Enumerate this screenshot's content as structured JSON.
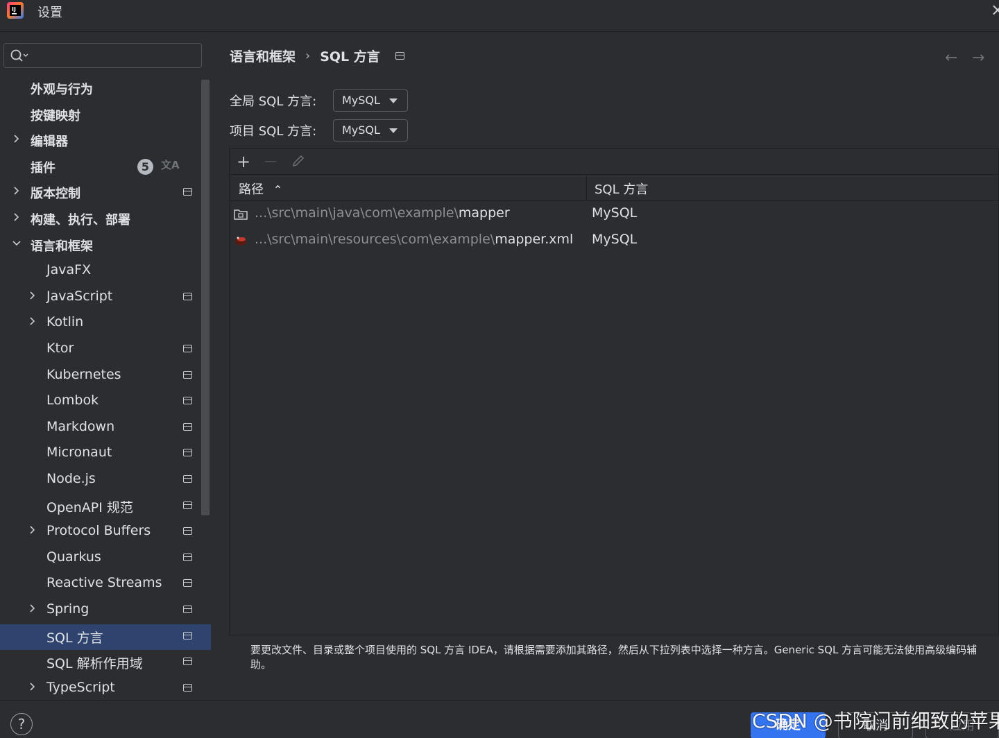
{
  "window": {
    "title": "设置",
    "close_glyph": "×"
  },
  "colors": {
    "background": "#2b2d30",
    "selection": "#2e436e",
    "primary_button": "#3574f0",
    "text": "#dfe1e5",
    "dim_text": "#8c8f94"
  },
  "sidebar": {
    "search_value": "",
    "items": [
      {
        "label": "外观与行为",
        "level": 0,
        "expandable": false,
        "pinned": false
      },
      {
        "label": "按键映射",
        "level": 0,
        "expandable": false,
        "pinned": false
      },
      {
        "label": "编辑器",
        "level": 0,
        "expandable": true,
        "expanded": false,
        "pinned": false
      },
      {
        "label": "插件",
        "level": 0,
        "expandable": false,
        "pinned": false,
        "badge": "5",
        "extra_icon": "translate-icon"
      },
      {
        "label": "版本控制",
        "level": 0,
        "expandable": true,
        "expanded": false,
        "pinned": true
      },
      {
        "label": "构建、执行、部署",
        "level": 0,
        "expandable": true,
        "expanded": false,
        "pinned": false
      },
      {
        "label": "语言和框架",
        "level": 0,
        "expandable": true,
        "expanded": true,
        "pinned": false
      },
      {
        "label": "JavaFX",
        "level": 1,
        "expandable": false,
        "pinned": false
      },
      {
        "label": "JavaScript",
        "level": 1,
        "expandable": true,
        "pinned": true
      },
      {
        "label": "Kotlin",
        "level": 1,
        "expandable": true,
        "pinned": false
      },
      {
        "label": "Ktor",
        "level": 1,
        "expandable": false,
        "pinned": true
      },
      {
        "label": "Kubernetes",
        "level": 1,
        "expandable": false,
        "pinned": true
      },
      {
        "label": "Lombok",
        "level": 1,
        "expandable": false,
        "pinned": true
      },
      {
        "label": "Markdown",
        "level": 1,
        "expandable": false,
        "pinned": true
      },
      {
        "label": "Micronaut",
        "level": 1,
        "expandable": false,
        "pinned": true
      },
      {
        "label": "Node.js",
        "level": 1,
        "expandable": false,
        "pinned": true
      },
      {
        "label": "OpenAPI 规范",
        "level": 1,
        "expandable": false,
        "pinned": true
      },
      {
        "label": "Protocol Buffers",
        "level": 1,
        "expandable": true,
        "pinned": true
      },
      {
        "label": "Quarkus",
        "level": 1,
        "expandable": false,
        "pinned": true
      },
      {
        "label": "Reactive Streams",
        "level": 1,
        "expandable": false,
        "pinned": true
      },
      {
        "label": "Spring",
        "level": 1,
        "expandable": true,
        "pinned": true
      },
      {
        "label": "SQL 方言",
        "level": 1,
        "expandable": false,
        "pinned": true,
        "selected": true
      },
      {
        "label": "SQL 解析作用域",
        "level": 1,
        "expandable": false,
        "pinned": true
      },
      {
        "label": "TypeScript",
        "level": 1,
        "expandable": true,
        "pinned": true
      }
    ]
  },
  "breadcrumb": {
    "parent": "语言和框架",
    "separator": "›",
    "current": "SQL 方言",
    "back_glyph": "←",
    "forward_glyph": "→"
  },
  "fields": {
    "global_label": "全局 SQL 方言:",
    "global_value": "MySQL",
    "project_label": "项目 SQL 方言:",
    "project_value": "MySQL"
  },
  "toolbar": {
    "add": "+",
    "remove": "—",
    "edit_icon": "pencil-icon"
  },
  "table": {
    "columns": [
      "路径",
      "SQL 方言"
    ],
    "sort_glyph": "⌃",
    "rows": [
      {
        "icon": "folder-icon",
        "path_prefix": "...\\src\\main\\java\\com\\example\\",
        "path_name": "mapper",
        "dialect": "MySQL"
      },
      {
        "icon": "mybatis-icon",
        "path_prefix": "...\\src\\main\\resources\\com\\example\\",
        "path_name": "mapper.xml",
        "dialect": "MySQL"
      }
    ]
  },
  "description": "要更改文件、目录或整个项目使用的 SQL 方言 IDEA，请根据需要添加其路径，然后从下拉列表中选择一种方言。Generic SQL 方言可能无法使用高级编码辅助。",
  "footer": {
    "help": "?",
    "ok": "确定",
    "cancel": "取消",
    "apply": "应用"
  },
  "watermark": "CSDN @书院门前细致的苹果"
}
